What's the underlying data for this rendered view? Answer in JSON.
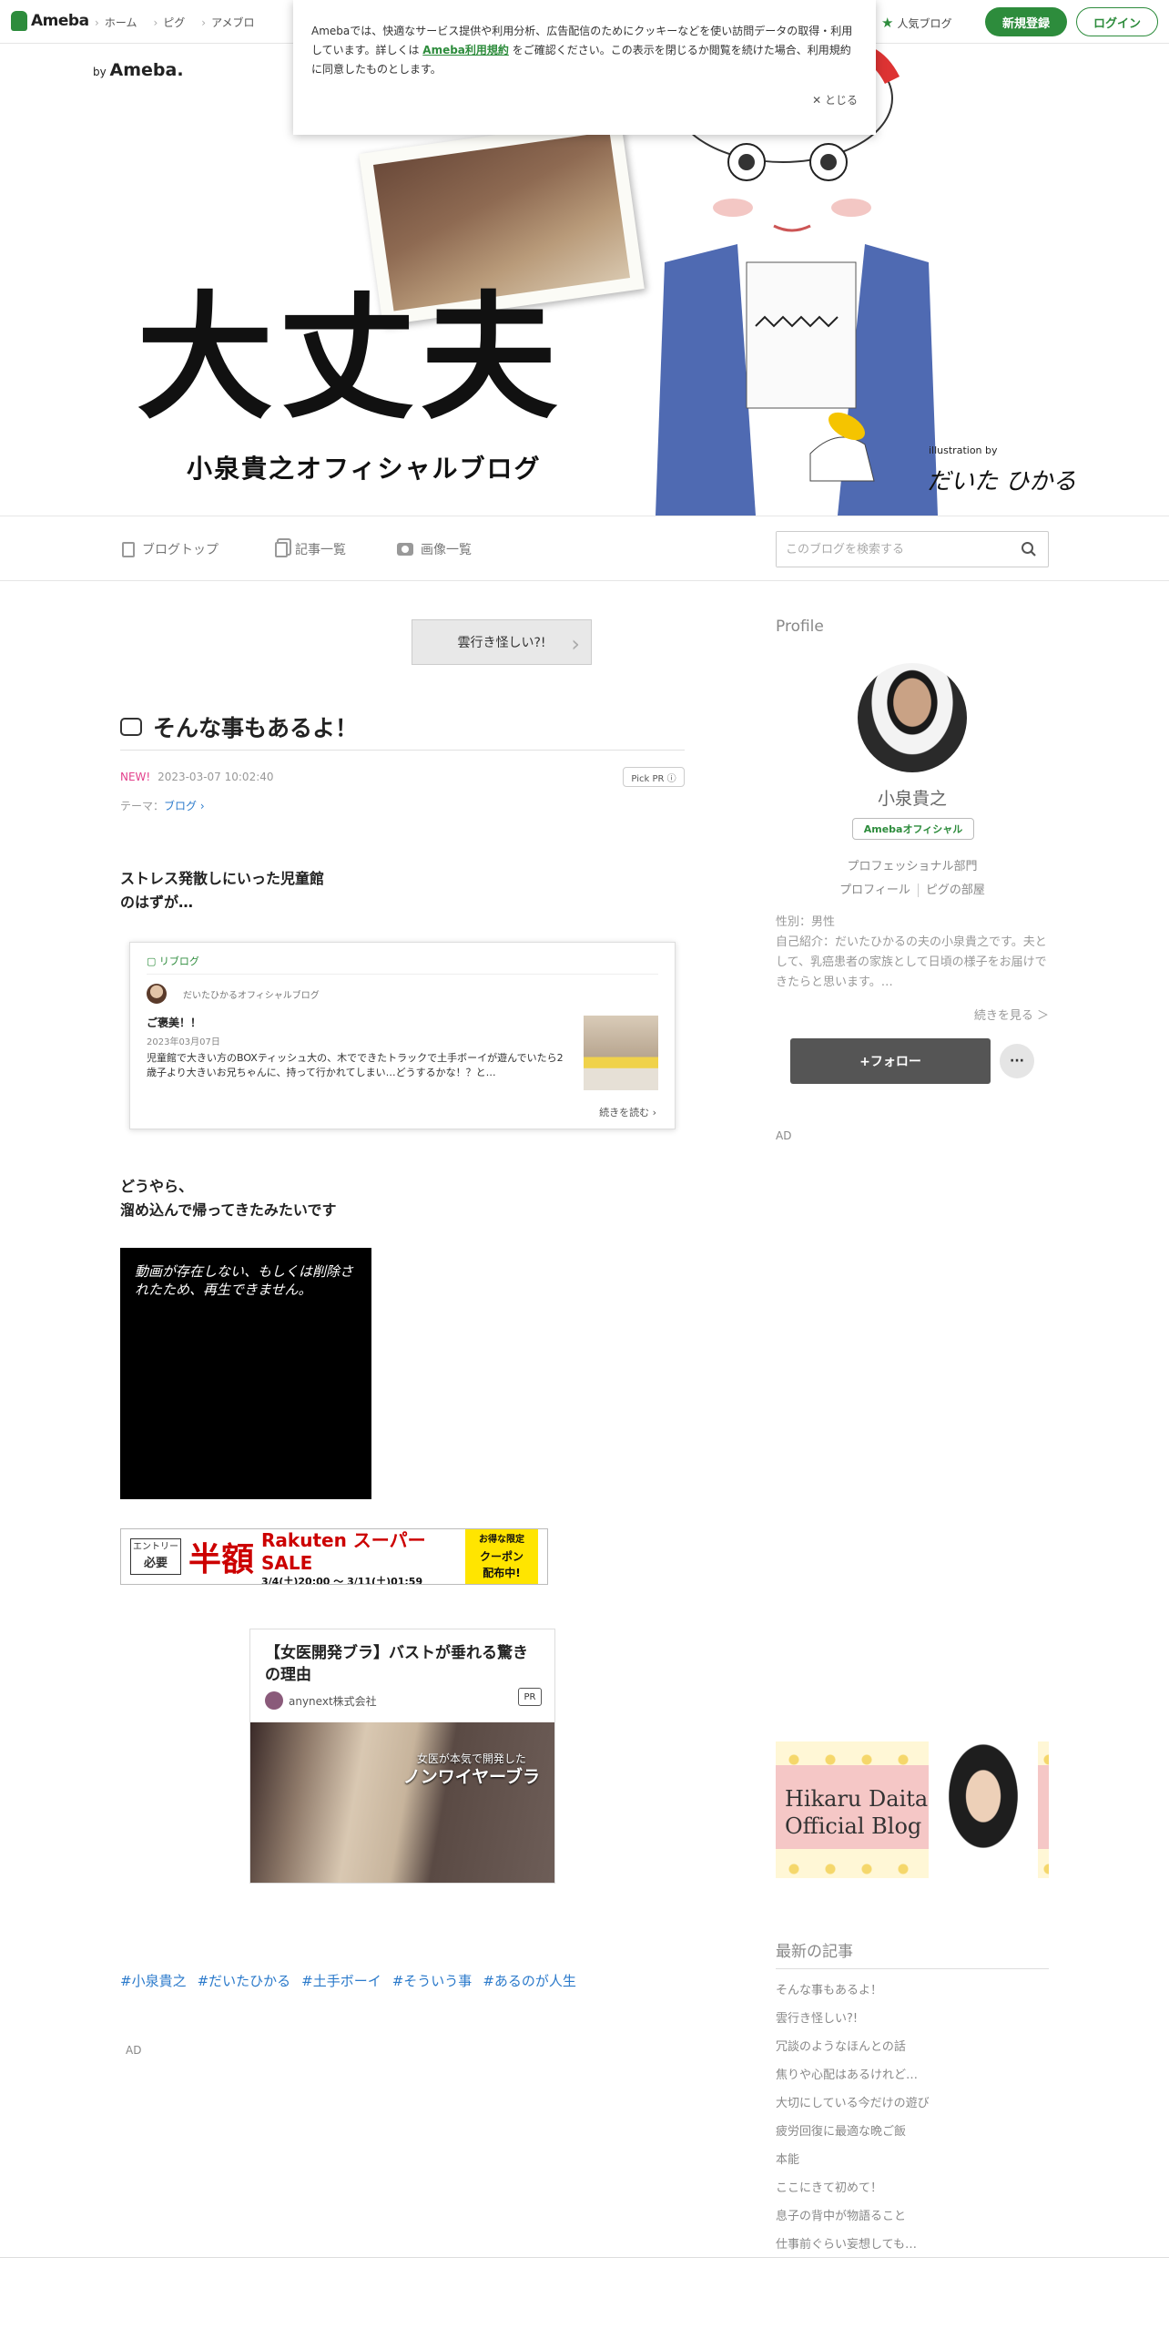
{
  "topbar": {
    "logo": "Ameba",
    "nav": [
      "ホーム",
      "ピグ",
      "アメブロ"
    ],
    "popular_blog": "人気ブログ",
    "register": "新規登録",
    "login": "ログイン"
  },
  "cookie": {
    "text_before": "Amebaでは、快適なサービス提供や利用分析、広告配信のためにクッキーなどを使い訪問データの取得・利用しています。詳しくは",
    "link": "Ameba利用規約",
    "text_after": "をご確認ください。この表示を閉じるか閲覧を続けた場合、利用規約に同意したものとします。",
    "close": "✕ とじる"
  },
  "header": {
    "by": "by",
    "by_brand": "Ameba.",
    "big_title": "大丈夫",
    "subtitle": "小泉貴之オフィシャルブログ",
    "illustration_by": "illustration by",
    "illustrator": "だいた ひかる"
  },
  "blognav": {
    "top": "ブログトップ",
    "list": "記事一覧",
    "images": "画像一覧",
    "search_placeholder": "このブログを検索する"
  },
  "entry": {
    "prev": "雲行き怪しい?!",
    "title": "そんな事もあるよ！",
    "new": "NEW!",
    "date": "2023-03-07 10:02:40",
    "pickpr": "Pick PR ⓘ",
    "theme_label": "テーマ：",
    "theme": "ブログ ›",
    "para1_line1": "ストレス発散しにいった児童館",
    "para1_line2": "のはずが…",
    "para2_line1": "どうやら、",
    "para2_line2": "溜め込んで帰ってきたみたいです",
    "video_msg": "動画が存在しない、もしくは削除されたため、再生できません。",
    "hashtags": [
      "#小泉貴之",
      "#だいたひかる",
      "#土手ボーイ",
      "#そういう事",
      "#あるのが人生"
    ],
    "ad_label": "AD"
  },
  "reblog": {
    "label": "リブログ",
    "author": "だいたひかるオフィシャルブログ",
    "title": "ご褒美！！",
    "date": "2023年03月07日",
    "excerpt": "児童館で大きい方のBOXティッシュ大の、木でできたトラックで土手ボーイが遊んでいたら2歳子より大きいお兄ちゃんに、持って行かれてしまい…どうするかな！？と…",
    "more": "続きを読む ›"
  },
  "sale": {
    "entry_line1": "エントリー",
    "entry_line2": "必要",
    "half": "半額",
    "rakuten": "Rakuten スーパーSALE",
    "dates": "3/4(土)20:00 〜 3/11(土)01:59",
    "coupon_line1": "お得な限定",
    "coupon_line2": "クーポン",
    "coupon_line3": "配布中!"
  },
  "ad": {
    "title": "【女医開発ブラ】バストが垂れる驚きの理由",
    "sponsor": "anynext株式会社",
    "pr": "PR",
    "img_line1": "女医が本気で開発した",
    "img_line2": "ノンワイヤーブラ"
  },
  "side": {
    "profile_heading": "Profile",
    "name": "小泉貴之",
    "official_badge": "Amebaオフィシャル",
    "genre": "プロフェッショナル部門",
    "profile_link": "プロフィール",
    "pig_link": "ピグの部屋",
    "bio_gender": "性別：男性",
    "bio_intro": "自己紹介：だいたひかるの夫の小泉貴之です。夫として、乳癌患者の家族として日頃の様子をお届けできたらと思います。…",
    "read_more": "続きを見る ＞",
    "follow": "+フォロー",
    "more": "···",
    "ad_label": "AD",
    "banner_line1": "Hikaru Daita",
    "banner_line2": "Official Blog",
    "recent_heading": "最新の記事",
    "recent": [
      "そんな事もあるよ！",
      "雲行き怪しい?!",
      "冗談のようなほんとの話",
      "焦りや心配はあるけれど…",
      "大切にしている今だけの遊び",
      "疲労回復に最適な晩ご飯",
      "本能",
      "ここにきて初めて！",
      "息子の背中が物語ること",
      "仕事前ぐらい妄想しても…"
    ]
  }
}
